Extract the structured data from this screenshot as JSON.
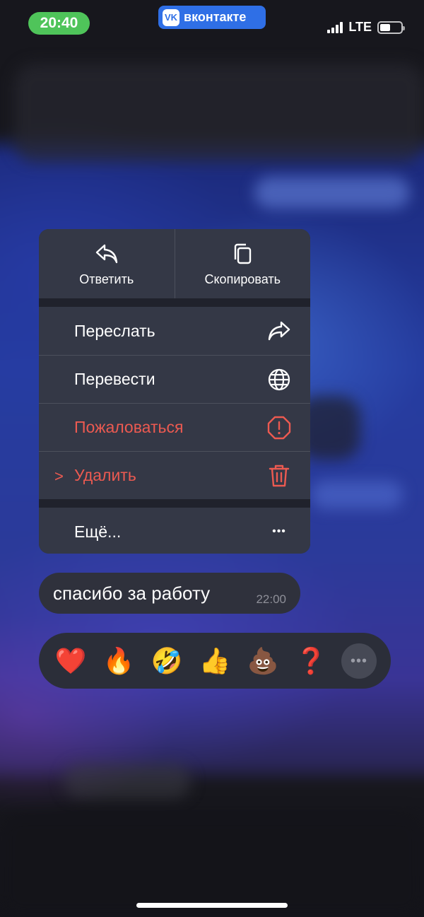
{
  "status_bar": {
    "time": "20:40",
    "app_badge": "вконтакте",
    "app_logo": "VK",
    "network": "LTE",
    "battery_level": 0.5
  },
  "context_menu": {
    "top_actions": [
      {
        "label": "Ответить",
        "icon": "reply-icon"
      },
      {
        "label": "Скопировать",
        "icon": "copy-icon"
      }
    ],
    "items": [
      {
        "label": "Переслать",
        "icon": "forward-icon",
        "danger": false
      },
      {
        "label": "Перевести",
        "icon": "globe-icon",
        "danger": false
      },
      {
        "label": "Пожаловаться",
        "icon": "report-icon",
        "danger": true
      },
      {
        "label": "Удалить",
        "icon": "trash-icon",
        "danger": true,
        "chevron": ">"
      }
    ],
    "more": {
      "label": "Ещё...",
      "icon": "ellipsis-icon",
      "glyph": "•••"
    }
  },
  "message": {
    "text": "спасибо за работу",
    "time": "22:00"
  },
  "reactions": [
    {
      "name": "heart",
      "glyph": "❤️"
    },
    {
      "name": "fire",
      "glyph": "🔥"
    },
    {
      "name": "laughing-tears",
      "glyph": "🤣"
    },
    {
      "name": "thumbs-up",
      "glyph": "👍"
    },
    {
      "name": "poop",
      "glyph": "💩"
    },
    {
      "name": "question",
      "glyph": "❓"
    }
  ],
  "reactions_more_glyph": "•••",
  "colors": {
    "danger": "#ec5a51",
    "menu_bg": "#343846",
    "time_pill": "#4fc45a",
    "vk_blue": "#2f6fe6"
  }
}
